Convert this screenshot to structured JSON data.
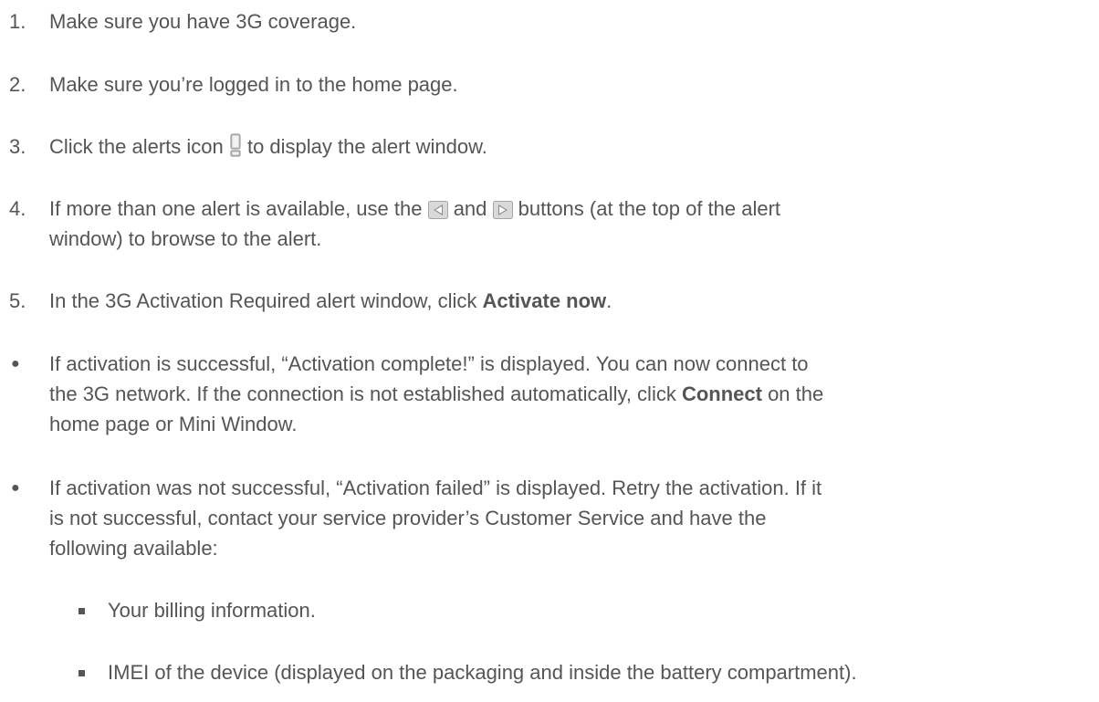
{
  "steps": [
    {
      "num": "1.",
      "text": "Make sure you have 3G coverage."
    },
    {
      "num": "2.",
      "text": "Make sure you’re logged in to the home page."
    },
    {
      "num": "3.",
      "before": "Click the alerts icon ",
      "icon": "alert-exclamation-icon",
      "after": " to display the alert window."
    },
    {
      "num": "4.",
      "part1": "If more than one alert is available, use the ",
      "icon1": "previous-arrow-icon",
      "part2": " and ",
      "icon2": "next-arrow-icon",
      "part3": " buttons (at the top of the alert",
      "line2": "window) to browse to the alert."
    },
    {
      "num": "5.",
      "before": "In the 3G Activation Required alert window, click ",
      "bold": "Activate now",
      "after": "."
    }
  ],
  "bullets": [
    {
      "marker": "●",
      "line1": "If activation is successful, “Activation complete!” is displayed. You can now connect to",
      "line2_before": "the 3G network. If the connection is not established automatically, click ",
      "line2_bold": "Connect",
      "line2_after": " on the",
      "line3": "home page or Mini Window."
    },
    {
      "marker": "●",
      "line1": "If activation was not successful, “Activation failed” is displayed. Retry the activation. If it",
      "line2": "is not successful, contact your service provider’s Customer Service and have the",
      "line3": "following available:"
    }
  ],
  "subitems": [
    {
      "text": "Your billing information."
    },
    {
      "text": "IMEI of the device (displayed on the packaging and inside the battery compartment)."
    }
  ],
  "colors": {
    "text": "#555555",
    "icon_fill": "#bfbfbf",
    "icon_border": "#999999"
  }
}
